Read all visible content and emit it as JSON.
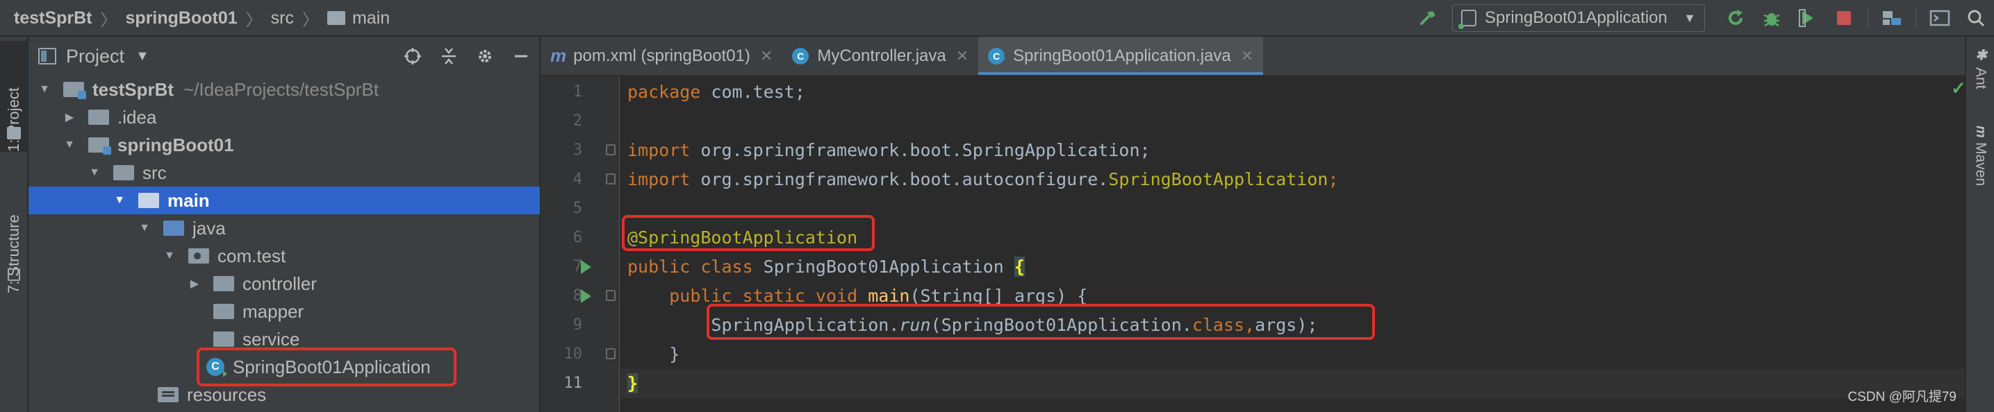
{
  "breadcrumb": {
    "items": [
      "testSprBt",
      "springBoot01",
      "src",
      "main"
    ]
  },
  "toolbar": {
    "run_config": "SpringBoot01Application"
  },
  "tool_strip": {
    "left_tabs": [
      "1: Project",
      "7: Structure"
    ],
    "right_tabs": [
      "Ant",
      "Maven"
    ]
  },
  "project_panel": {
    "title": "Project",
    "tree": [
      {
        "label": "testSprBt",
        "path": "~/IdeaProjects/testSprBt"
      },
      {
        "label": ".idea"
      },
      {
        "label": "springBoot01"
      },
      {
        "label": "src"
      },
      {
        "label": "main"
      },
      {
        "label": "java"
      },
      {
        "label": "com.test"
      },
      {
        "label": "controller"
      },
      {
        "label": "mapper"
      },
      {
        "label": "service"
      },
      {
        "label": "SpringBoot01Application"
      },
      {
        "label": "resources"
      }
    ]
  },
  "editor": {
    "tabs": [
      {
        "label": "pom.xml (springBoot01)",
        "icon": "m"
      },
      {
        "label": "MyController.java",
        "icon": "C"
      },
      {
        "label": "SpringBoot01Application.java",
        "icon": "C"
      }
    ],
    "line_numbers": [
      "1",
      "2",
      "3",
      "4",
      "5",
      "6",
      "7",
      "8",
      "9",
      "10",
      "11"
    ],
    "code": {
      "l1_kw": "package",
      "l1_rest": " com.test;",
      "l3_kw": "import",
      "l3_rest": " org.springframework.boot.SpringApplication;",
      "l4_kw": "import",
      "l4_rest": " org.springframework.boot.autoconfigure.",
      "l4_cls": "SpringBootApplication",
      "l4_end": ";",
      "l6_anno": "@SpringBootApplication",
      "l7_kw": "public class",
      "l7_rest": " SpringBoot01Application ",
      "l7_brace": "{",
      "l8_kw": "public static void",
      "l8_fn": "main",
      "l8_rest": "(String[] args) {",
      "l9_a": "SpringApplication.",
      "l9_run": "run",
      "l9_b": "(SpringBoot01Application.",
      "l9_cls": "class",
      "l9_comma": ",",
      "l9_c": "args);",
      "l10": "}",
      "l11": "}"
    }
  },
  "watermark": "CSDN @阿凡提79"
}
